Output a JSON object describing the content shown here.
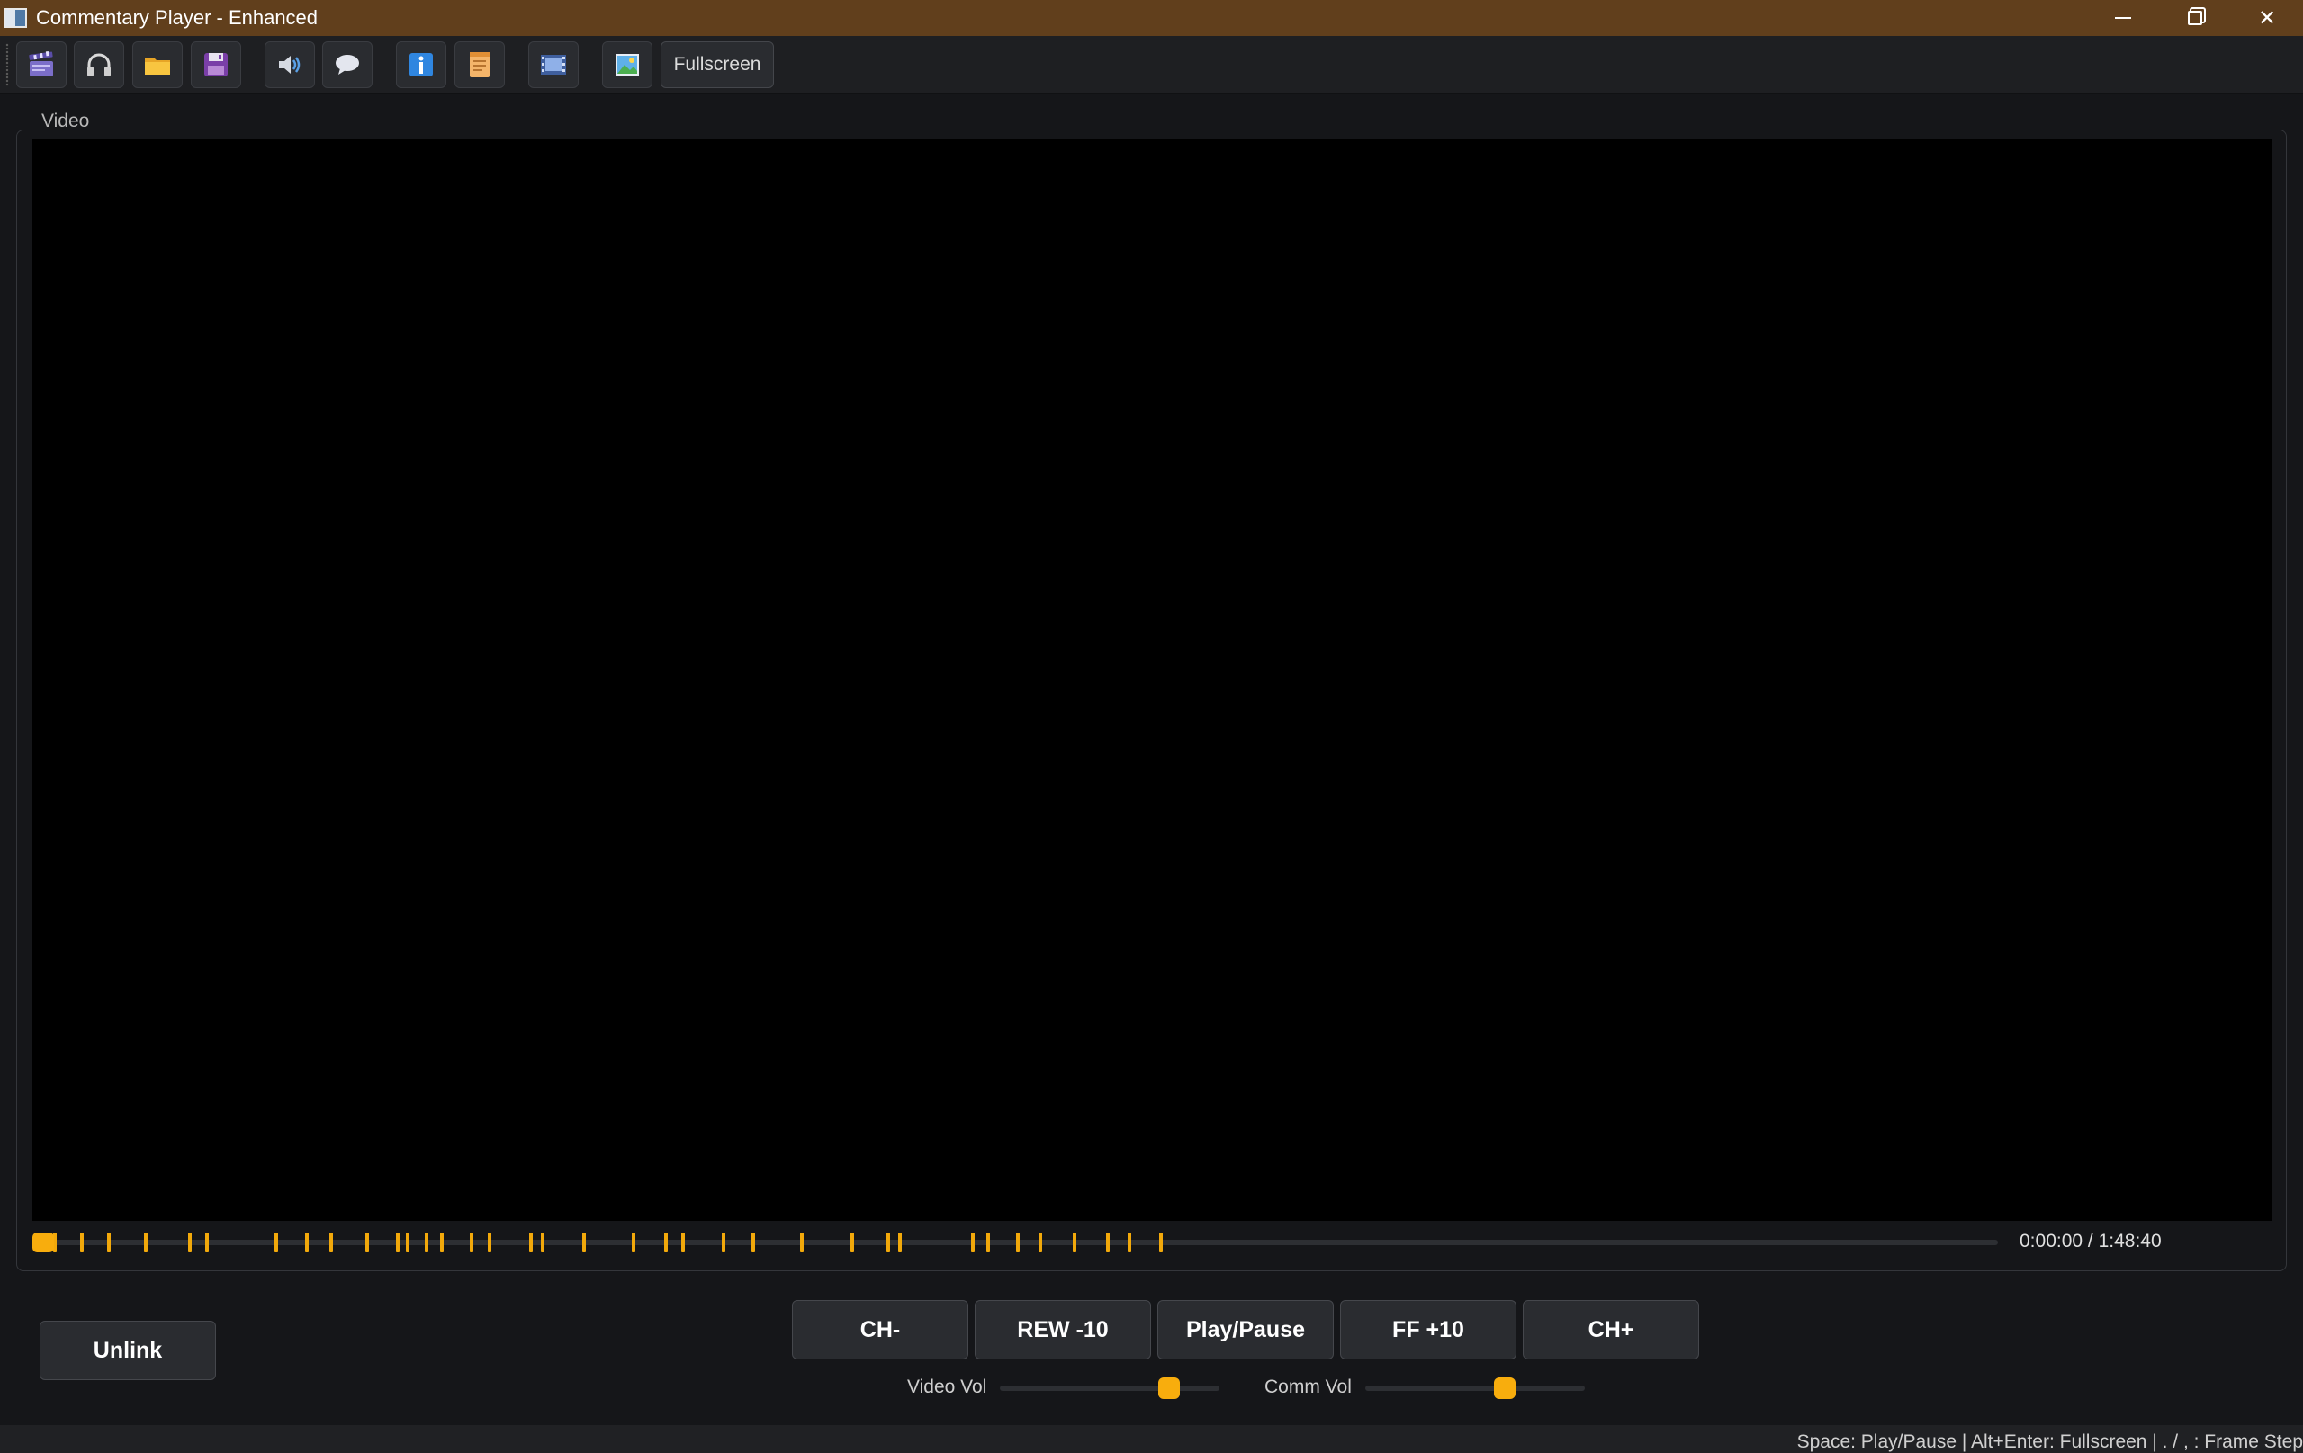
{
  "window": {
    "title": "Commentary Player - Enhanced"
  },
  "toolbar": {
    "buttons": [
      {
        "name": "open-video",
        "icon": "clapperboard-icon"
      },
      {
        "name": "open-commentary",
        "icon": "headphones-icon"
      },
      {
        "name": "open-folder",
        "icon": "folder-icon"
      },
      {
        "name": "save",
        "icon": "floppy-disk-icon"
      },
      {
        "name": "audio-settings",
        "icon": "speaker-icon"
      },
      {
        "name": "subtitles",
        "icon": "speech-bubble-icon"
      },
      {
        "name": "info",
        "icon": "info-icon"
      },
      {
        "name": "notes",
        "icon": "notepad-icon"
      },
      {
        "name": "film-strip",
        "icon": "film-strip-icon"
      },
      {
        "name": "screenshot",
        "icon": "picture-icon"
      }
    ],
    "fullscreen_label": "Fullscreen"
  },
  "video": {
    "group_label": "Video",
    "time_display": "0:00:00 / 1:48:40",
    "position_fraction": 0.0,
    "chapter_markers_fraction": [
      0.0113,
      0.025,
      0.0387,
      0.0579,
      0.0802,
      0.0887,
      0.1243,
      0.1395,
      0.1518,
      0.1703,
      0.1857,
      0.1908,
      0.2004,
      0.2082,
      0.2233,
      0.2325,
      0.2536,
      0.2596,
      0.2807,
      0.3058,
      0.3223,
      0.3312,
      0.3518,
      0.3669,
      0.3915,
      0.4171,
      0.4356,
      0.4413,
      0.4786,
      0.4863,
      0.5015,
      0.5126,
      0.5303,
      0.5472,
      0.5582,
      0.5741
    ]
  },
  "controls": {
    "unlink": "Unlink",
    "ch_minus": "CH-",
    "rew": "REW -10",
    "play_pause": "Play/Pause",
    "ff": "FF +10",
    "ch_plus": "CH+",
    "video_vol_label": "Video Vol",
    "video_vol": 0.8,
    "comm_vol_label": "Comm Vol",
    "comm_vol": 0.65
  },
  "status": {
    "text": "Space: Play/Pause | Alt+Enter: Fullscreen | . / , : Frame Step"
  },
  "colors": {
    "titlebar": "#613f1c",
    "accent": "#f8ad0d",
    "background": "#151619",
    "video": "#000000"
  }
}
